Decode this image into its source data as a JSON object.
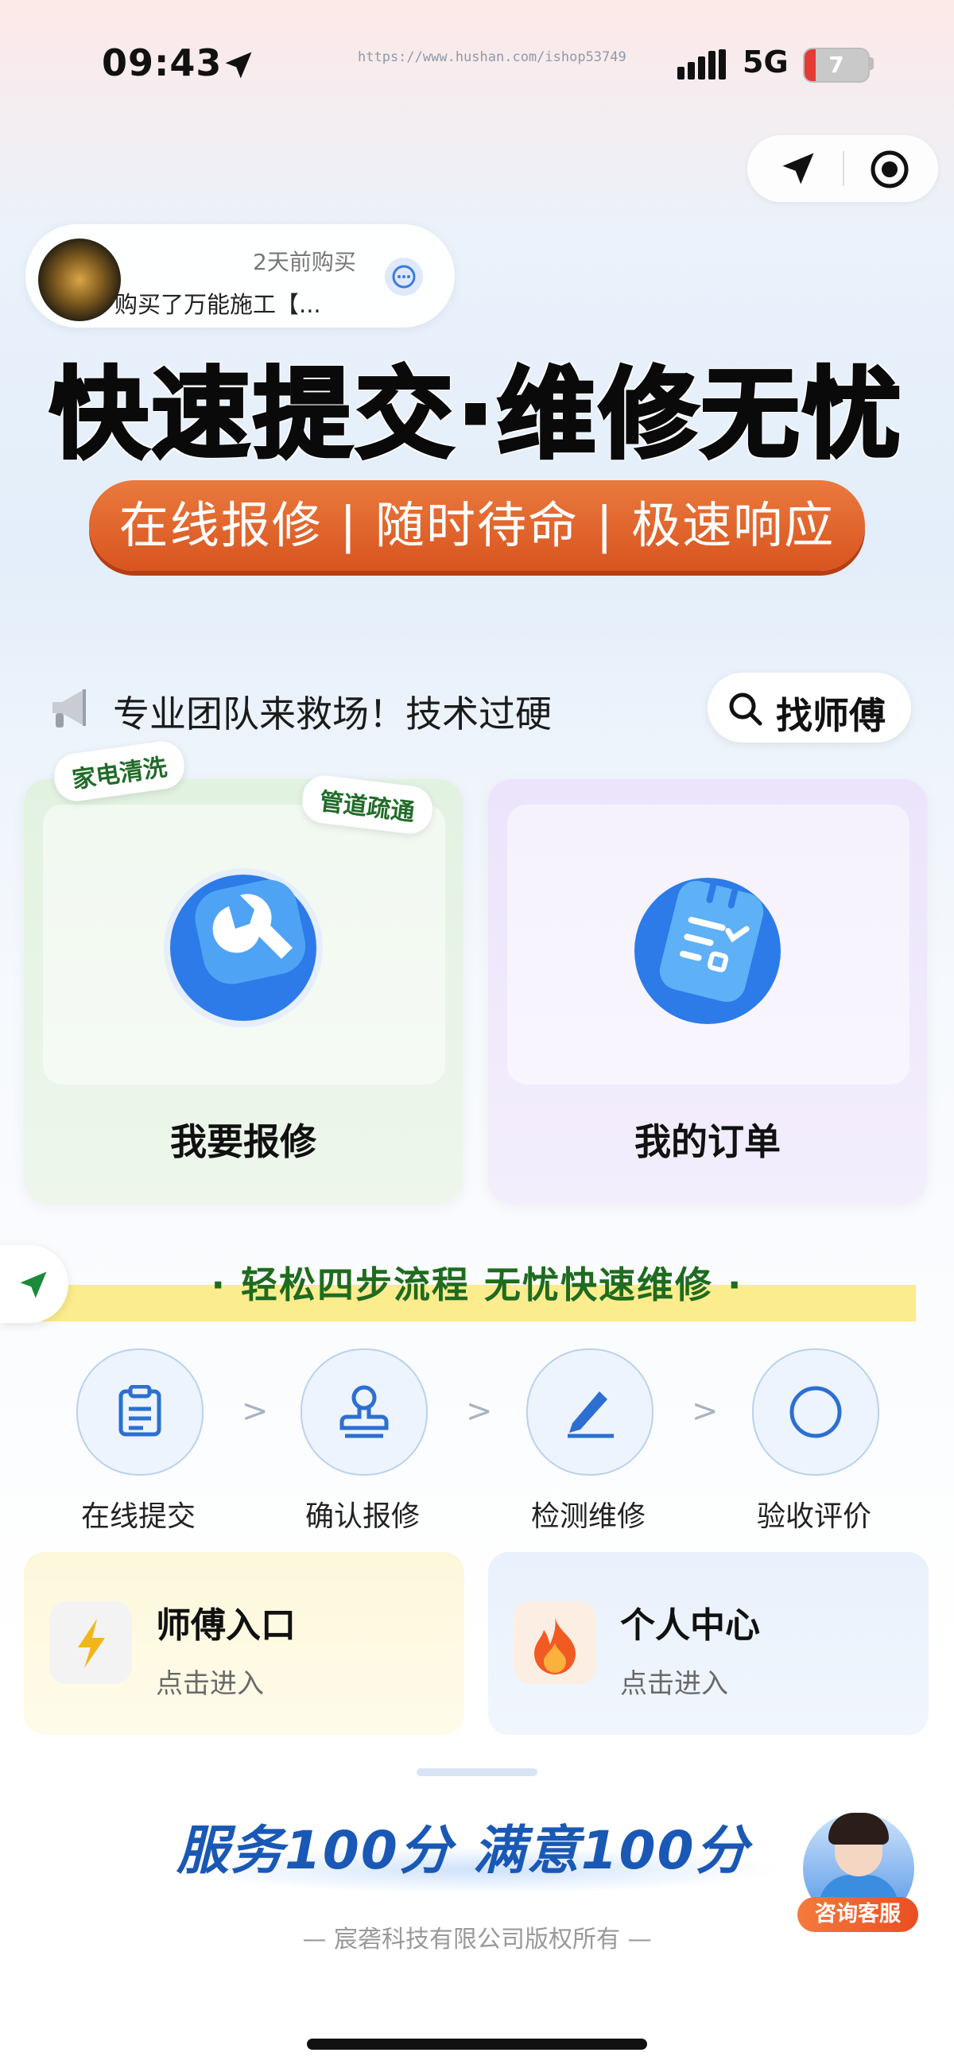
{
  "status_bar": {
    "time": "09:43",
    "url": "https://www.hushan.com/ishop53749",
    "network": "5G",
    "battery": "7",
    "battery_level": 0.07
  },
  "capsule": {
    "location_icon": "navigation-arrow-icon",
    "target_icon": "record-circle-icon"
  },
  "purchase_popup": {
    "time": "2天前购买",
    "text": "购买了万能施工【...",
    "chat_icon": "chat-bubble-icon"
  },
  "banner": {
    "headline": "快速提交·维修无忧",
    "subline": "在线报修 | 随时待命 | 极速响应"
  },
  "notice": {
    "text": "专业团队来救场！技术过硬",
    "find_button": "找师傅"
  },
  "cards": [
    {
      "label": "我要报修",
      "icon": "wrench-icon",
      "color": "#2c7be8"
    },
    {
      "label": "我的订单",
      "icon": "clipboard-checklist-icon",
      "color": "#2c7be8"
    }
  ],
  "tags": [
    "家电清洗",
    "管道疏通"
  ],
  "steps_section": {
    "title": "· 轻松四步流程 无忧快速维修 ·",
    "steps": [
      {
        "label": "在线提交",
        "icon": "clipboard-icon"
      },
      {
        "label": "确认报修",
        "icon": "stamp-icon"
      },
      {
        "label": "检测维修",
        "icon": "pen-icon"
      },
      {
        "label": "验收评价",
        "icon": "circle-icon"
      }
    ],
    "separator": ">"
  },
  "entries": [
    {
      "title": "师傅入口",
      "subtitle": "点击进入",
      "icon": "lightning-icon"
    },
    {
      "title": "个人中心",
      "subtitle": "点击进入",
      "icon": "fire-icon"
    }
  ],
  "footer": {
    "slogan": "服务100分 满意100分",
    "copyright": "— 宸砻科技有限公司版权所有 —",
    "service_button": "咨询客服"
  },
  "colors": {
    "accent_blue": "#1a58b6",
    "banner_orange": "#d9541f",
    "section_green": "#1f6b1f"
  }
}
